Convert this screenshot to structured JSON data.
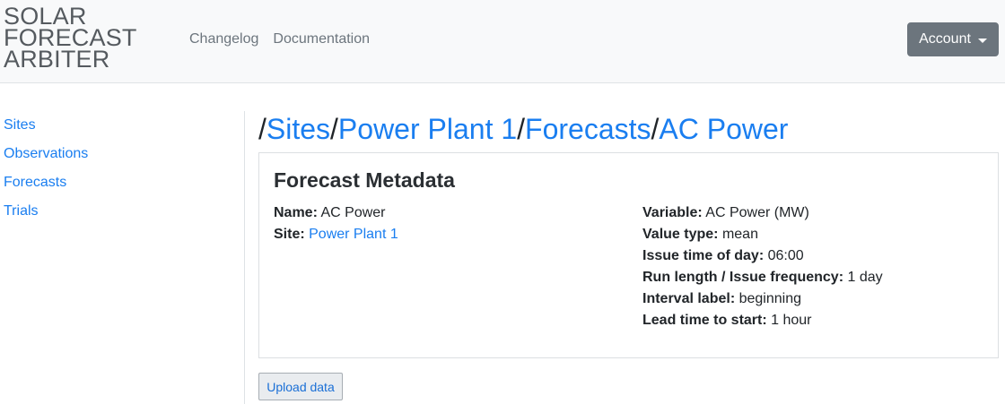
{
  "navbar": {
    "brand_lines": [
      "SOLAR",
      "FORECAST",
      "ARBITER"
    ],
    "links": [
      "Changelog",
      "Documentation"
    ],
    "account_label": "Account"
  },
  "sidebar": {
    "items": [
      {
        "label": "Sites"
      },
      {
        "label": "Observations"
      },
      {
        "label": "Forecasts"
      },
      {
        "label": "Trials"
      }
    ]
  },
  "breadcrumb": {
    "separator": "/",
    "items": [
      "Sites",
      "Power Plant 1",
      "Forecasts",
      "AC Power"
    ]
  },
  "card": {
    "title": "Forecast Metadata",
    "left": [
      {
        "label": "Name:",
        "value": "AC Power"
      },
      {
        "label": "Site:",
        "value": "Power Plant 1"
      }
    ],
    "right": [
      {
        "label": "Variable:",
        "value": "AC Power (MW)"
      },
      {
        "label": "Value type:",
        "value": "mean"
      },
      {
        "label": "Issue time of day:",
        "value": "06:00"
      },
      {
        "label": "Run length / Issue frequency:",
        "value": "1 day"
      },
      {
        "label": "Interval label:",
        "value": "beginning"
      },
      {
        "label": "Lead time to start:",
        "value": "1 hour"
      }
    ]
  },
  "upload_label": "Upload data",
  "colors": {
    "link": "#1a7ef0",
    "navbar_bg": "#f8f9fa",
    "account_bg": "#6c757d"
  },
  "icons": {
    "account_caret": "caret-down-icon"
  }
}
